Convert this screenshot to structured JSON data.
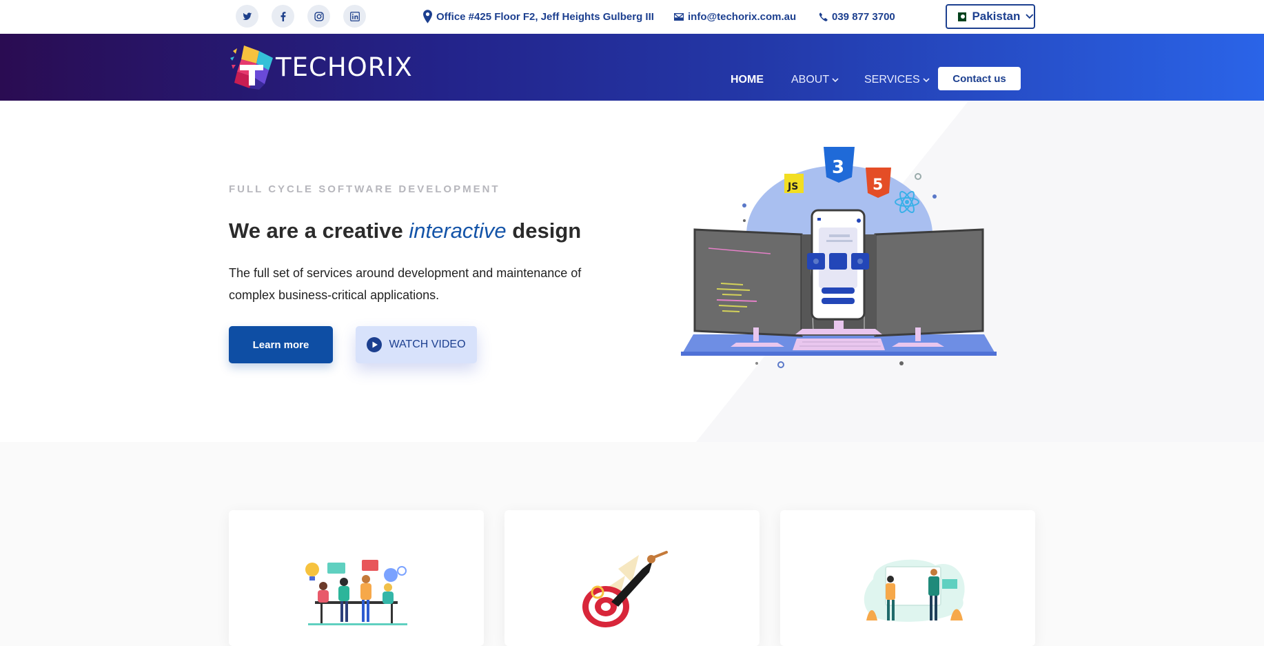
{
  "topbar": {
    "social": [
      {
        "name": "twitter-icon"
      },
      {
        "name": "facebook-icon"
      },
      {
        "name": "instagram-icon"
      },
      {
        "name": "linkedin-icon"
      }
    ],
    "address": "Office #425 Floor F2, Jeff Heights Gulberg III",
    "email": "info@techorix.com.au",
    "phone": "039 877 3700",
    "country": "Pakistan"
  },
  "header": {
    "logo_text": "TECHORIX",
    "nav": {
      "home": "HOME",
      "about": "ABOUT",
      "services": "SERVICES",
      "contact": "Contact us"
    }
  },
  "hero": {
    "eyebrow": "FULL CYCLE SOFTWARE DEVELOPMENT",
    "title_pre": "We are a creative ",
    "title_em": "interactive",
    "title_post": " design",
    "description": "The full set of services around development and maintenance of complex business-critical applications.",
    "learn_more": "Learn more",
    "watch_video": "WATCH VIDEO",
    "badges": {
      "js": "JS",
      "css": "3",
      "html": "5"
    }
  },
  "colors": {
    "primary": "#0e4ea4",
    "nav_text": "#1c3f8f",
    "header_start": "#2a0c52",
    "header_end": "#2a64e8"
  }
}
